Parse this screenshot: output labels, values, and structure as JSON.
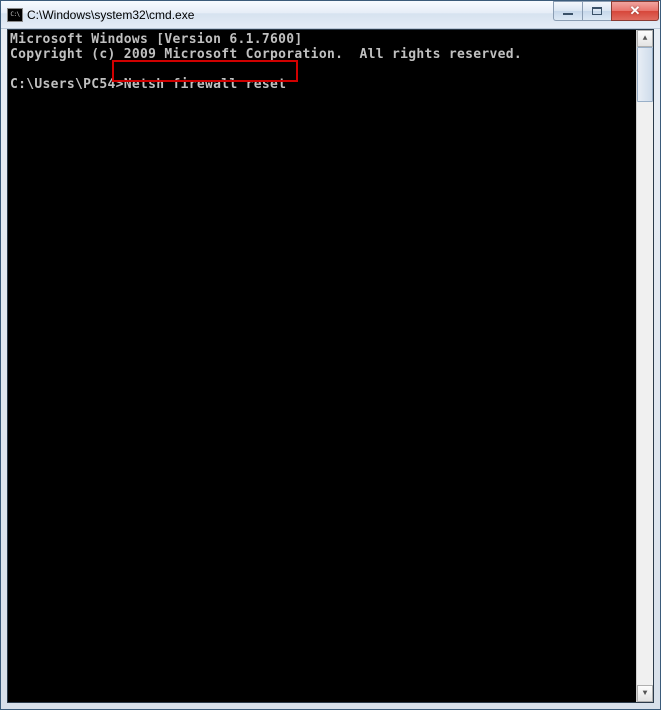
{
  "window": {
    "title": "C:\\Windows\\system32\\cmd.exe",
    "icon_name": "cmd-icon",
    "icon_text": "C:\\"
  },
  "console": {
    "line1": "Microsoft Windows [Version 6.1.7600]",
    "line2": "Copyright (c) 2009 Microsoft Corporation.  All rights reserved.",
    "blank": "",
    "prompt": "C:\\Users\\PC54>",
    "command": "Netsh firewall reset"
  },
  "controls": {
    "minimize": "minimize",
    "maximize": "maximize",
    "close": "close"
  },
  "scrollbar": {
    "up": "▲",
    "down": "▼"
  }
}
